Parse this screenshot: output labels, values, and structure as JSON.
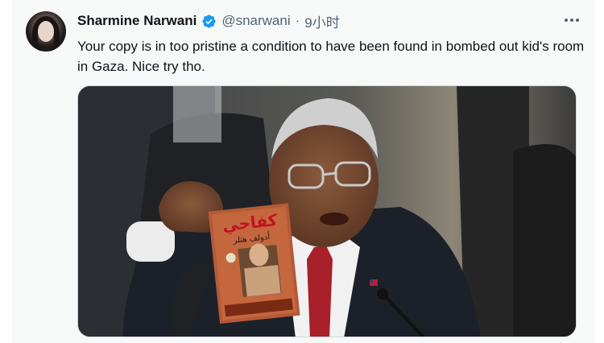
{
  "tweet": {
    "author": {
      "name": "Sharmine Narwani",
      "handle": "@snarwani",
      "verified": true,
      "avatar_icon": "profile-avatar"
    },
    "separator": "·",
    "time": "9小时",
    "more_icon": "more-options-icon",
    "text": "Your copy is in too pristine a condition to have been found in bombed out kid's room in Gaza. Nice try tho.",
    "media": {
      "book_title": "كفاحي",
      "book_author": "أدولف هتلر"
    }
  },
  "colors": {
    "accent": "#1d9bf0",
    "muted": "#536471",
    "text": "#0f1419",
    "background": "#f7f9f9"
  }
}
